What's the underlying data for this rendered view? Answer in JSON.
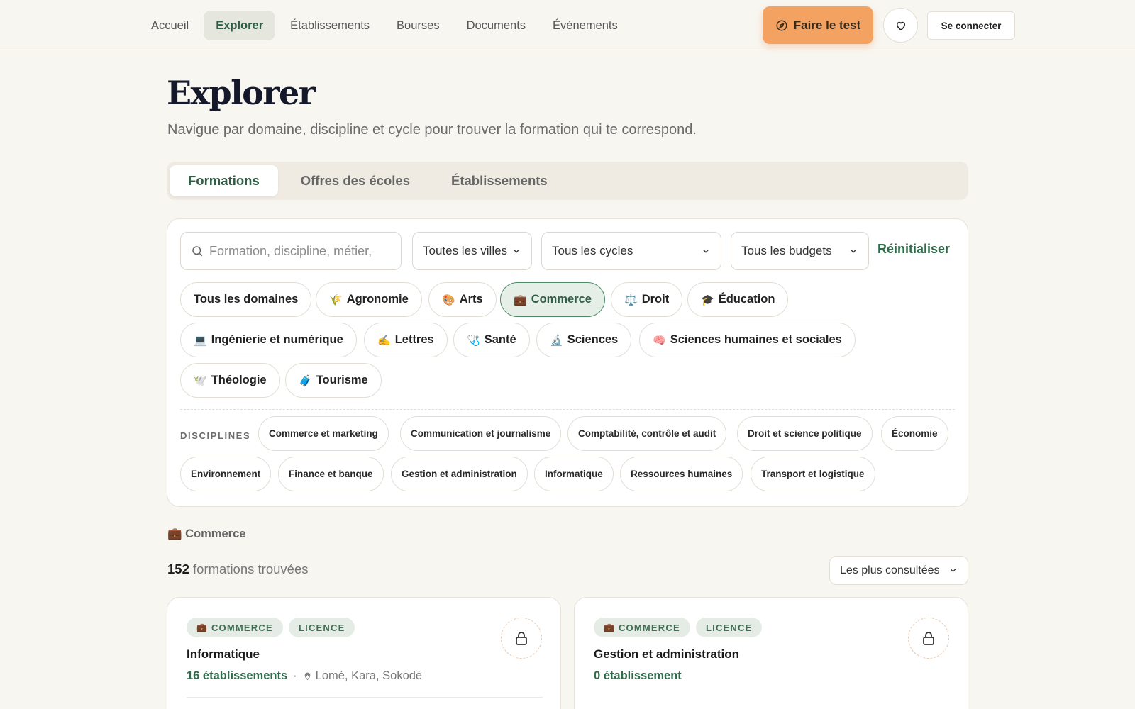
{
  "nav": {
    "items": [
      "Accueil",
      "Explorer",
      "Établissements",
      "Bourses",
      "Documents",
      "Événements"
    ],
    "active": "Explorer",
    "cta_label": "Faire le test",
    "login_label": "Se connecter"
  },
  "header": {
    "title": "Explorer",
    "subtitle": "Navigue par domaine, discipline et cycle pour trouver la formation qui te correspond."
  },
  "tabs": {
    "items": [
      "Formations",
      "Offres des écoles",
      "Établissements"
    ],
    "active": "Formations"
  },
  "filters": {
    "search_placeholder": "Formation, discipline, métier,",
    "city_select": "Toutes les villes",
    "cycle_select": "Tous les cycles",
    "budget_select": "Tous les budgets",
    "reset_label": "Réinitialiser"
  },
  "domains": [
    {
      "emoji": "",
      "label": "Tous les domaines"
    },
    {
      "emoji": "🌾",
      "label": "Agronomie"
    },
    {
      "emoji": "🎨",
      "label": "Arts"
    },
    {
      "emoji": "💼",
      "label": "Commerce",
      "active": true
    },
    {
      "emoji": "⚖️",
      "label": "Droit"
    },
    {
      "emoji": "🎓",
      "label": "Éducation"
    },
    {
      "emoji": "💻",
      "label": "Ingénierie et numérique"
    },
    {
      "emoji": "✍️",
      "label": "Lettres"
    },
    {
      "emoji": "🩺",
      "label": "Santé"
    },
    {
      "emoji": "🔬",
      "label": "Sciences"
    },
    {
      "emoji": "🧠",
      "label": "Sciences humaines et sociales"
    },
    {
      "emoji": "🕊️",
      "label": "Théologie"
    },
    {
      "emoji": "🧳",
      "label": "Tourisme"
    }
  ],
  "disciplines": {
    "label": "DISCIPLINES",
    "items": [
      "Commerce et marketing",
      "Communication et journalisme",
      "Comptabilité, contrôle et audit",
      "Droit et science politique",
      "Économie",
      "Environnement",
      "Finance et banque",
      "Gestion et administration",
      "Informatique",
      "Ressources humaines",
      "Transport et logistique"
    ]
  },
  "results": {
    "selected_domain": "💼 Commerce",
    "count": "152",
    "count_suffix": "formations trouvées",
    "sort_label": "Les plus consultées",
    "cards": [
      {
        "domain_badge": "COMMERCE",
        "level_badge": "LICENCE",
        "title": "Informatique",
        "establishments": "16 établissements",
        "separator": "·",
        "cities": "Lomé, Kara, Sokodé"
      },
      {
        "domain_badge": "COMMERCE",
        "level_badge": "LICENCE",
        "title": "Gestion et administration",
        "establishments": "0 établissement",
        "separator": "",
        "cities": ""
      }
    ]
  },
  "colors": {
    "accent_green": "#2f5d45",
    "cta_orange": "#f4a261",
    "background": "#f8f6f1"
  }
}
